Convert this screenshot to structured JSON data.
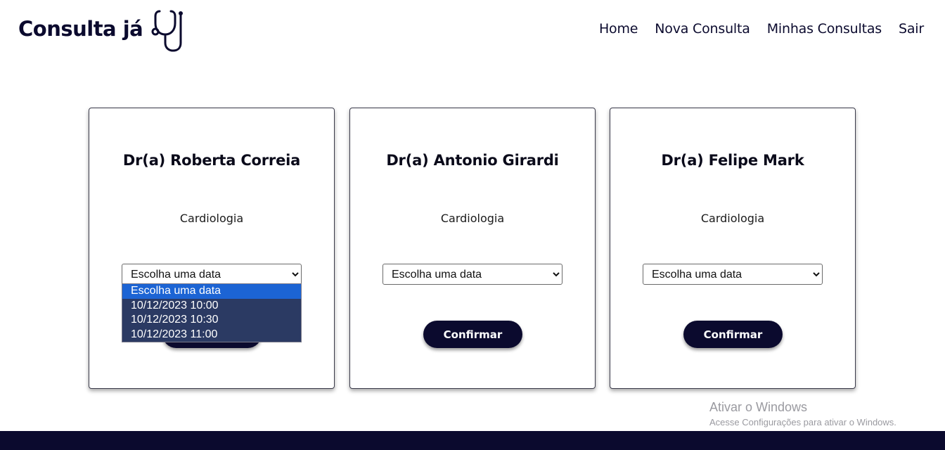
{
  "header": {
    "logo_text": "Consulta já",
    "nav": [
      "Home",
      "Nova Consulta",
      "Minhas Consultas",
      "Sair"
    ]
  },
  "cards": [
    {
      "doctor": "Dr(a) Roberta Correia",
      "specialty": "Cardiologia",
      "select_value": "Escolha uma data",
      "button": "Confirmar"
    },
    {
      "doctor": "Dr(a) Antonio Girardi",
      "specialty": "Cardiologia",
      "select_value": "Escolha uma data",
      "button": "Confirmar"
    },
    {
      "doctor": "Dr(a) Felipe Mark",
      "specialty": "Cardiologia",
      "select_value": "Escolha uma data",
      "button": "Confirmar"
    }
  ],
  "dropdown": {
    "options": [
      "Escolha uma data",
      "10/12/2023 10:00",
      "10/12/2023 10:30",
      "10/12/2023 11:00"
    ],
    "highlighted_option": "Escolha uma data"
  },
  "watermark": {
    "title": "Ativar o Windows",
    "subtitle": "Acesse Configurações para ativar o Windows."
  },
  "colors": {
    "brand": "#0b0a2e",
    "dropdown_bg": "#2b3a63",
    "dropdown_highlight": "#1c64d4"
  }
}
